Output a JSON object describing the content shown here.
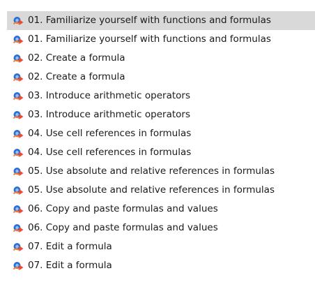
{
  "file_list": {
    "selected_index": 0,
    "icon": "video-file-icon",
    "items": [
      {
        "label": "01. Familiarize yourself with functions and formulas"
      },
      {
        "label": "01. Familiarize yourself with functions and formulas"
      },
      {
        "label": "02. Create a formula"
      },
      {
        "label": "02. Create a formula"
      },
      {
        "label": "03. Introduce arithmetic operators"
      },
      {
        "label": "03. Introduce arithmetic operators"
      },
      {
        "label": "04. Use cell references in formulas"
      },
      {
        "label": "04. Use cell references in formulas"
      },
      {
        "label": "05. Use absolute and relative references in formulas"
      },
      {
        "label": "05. Use absolute and relative references in formulas"
      },
      {
        "label": "06. Copy and paste formulas and values"
      },
      {
        "label": "06. Copy and paste formulas and values"
      },
      {
        "label": "07. Edit a formula"
      },
      {
        "label": "07. Edit a formula"
      }
    ]
  },
  "colors": {
    "selected_background": "#d9d9d9",
    "text": "#1a1a1a"
  }
}
